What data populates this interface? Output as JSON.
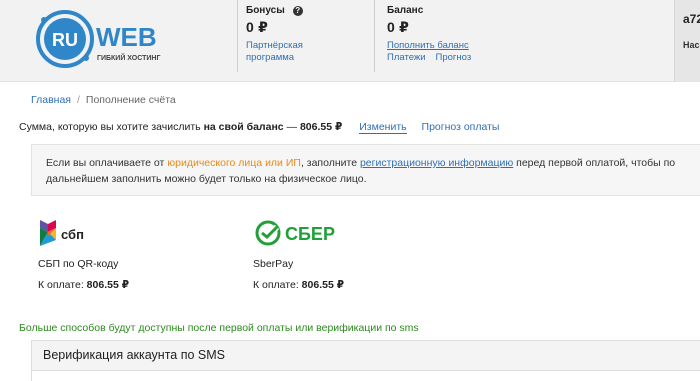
{
  "header": {
    "logo_text": "RU",
    "logo_word": "WEB",
    "logo_tagline": "ГИБКИЙ ХОСТИНГ",
    "bonus": {
      "label": "Бонусы",
      "value": "0 ₽",
      "link1": "Партнёрская",
      "link2": "программа"
    },
    "balance": {
      "label": "Баланс",
      "value": "0 ₽",
      "topup": "Пополнить баланс",
      "payments": "Платежи",
      "forecast": "Прогноз"
    },
    "user": {
      "name": "a72",
      "sub": "Нас"
    }
  },
  "breadcrumb": {
    "home": "Главная",
    "separator": "/",
    "current": "Пополнение счёта"
  },
  "amount": {
    "prefix": "Сумма, которую вы хотите зачислить",
    "bold": "на свой баланс",
    "dash": "—",
    "value": "806.55 ₽",
    "change": "Изменить",
    "forecast": "Прогноз оплаты"
  },
  "notice": {
    "part1": "Если вы оплачиваете от",
    "orange": "юридического лица или ИП",
    "part2": ", заполните",
    "link": "регистрационную информацию",
    "part3": "перед первой оплатой, чтобы по",
    "line2": "дальнейшем заполнить можно будет только на физическое лицо."
  },
  "payments": [
    {
      "logo_text": "сбп",
      "name": "СБП по QR-коду",
      "price_label": "К оплате:",
      "price": "806.55 ₽"
    },
    {
      "logo_text": "СБЕР",
      "name": "SberPay",
      "price_label": "К оплате:",
      "price": "806.55 ₽"
    }
  ],
  "more_info": "Больше способов будут доступны после первой оплаты или верификации по sms",
  "sms_panel": {
    "title": "Верификация аккаунта по SMS"
  },
  "colors": {
    "link": "#2f6fb5",
    "orange": "#e88a1a",
    "green_text": "#2c8a1e",
    "logo_blue": "#2f86c8",
    "sber_green": "#21a038"
  }
}
